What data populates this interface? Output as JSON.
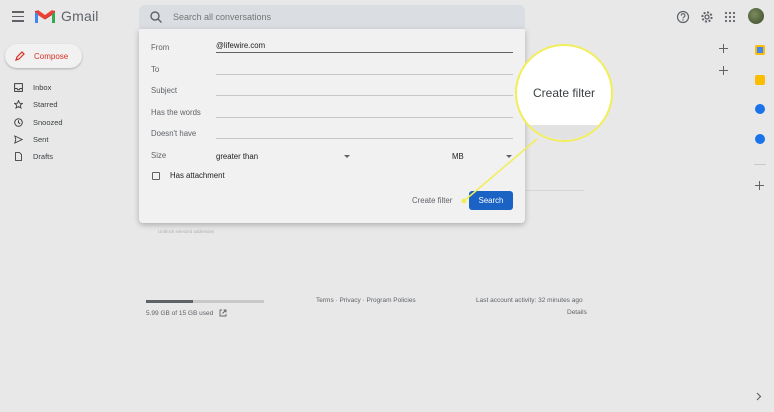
{
  "app": {
    "logo_text": "Gmail"
  },
  "search": {
    "placeholder": "Search all conversations"
  },
  "compose": {
    "label": "Compose"
  },
  "nav": {
    "items": [
      {
        "label": "Inbox",
        "icon": "inbox-icon"
      },
      {
        "label": "Starred",
        "icon": "star-icon"
      },
      {
        "label": "Snoozed",
        "icon": "clock-icon"
      },
      {
        "label": "Sent",
        "icon": "send-icon"
      },
      {
        "label": "Drafts",
        "icon": "draft-icon"
      }
    ]
  },
  "filter": {
    "from_label": "From",
    "from_value": "@lifewire.com",
    "to_label": "To",
    "to_value": "",
    "subject_label": "Subject",
    "subject_value": "",
    "has_words_label": "Has the words",
    "has_words_value": "",
    "doesnt_have_label": "Doesn't have",
    "doesnt_have_value": "",
    "size_label": "Size",
    "size_operator": "greater than",
    "size_unit": "MB",
    "attachment_label": "Has attachment",
    "create_filter_label": "Create filter",
    "search_button_label": "Search"
  },
  "background": {
    "unblock_text": "Unblock selected addresses"
  },
  "footer": {
    "storage_text": "5.99 GB of 15 GB used",
    "storage_fraction": 0.4,
    "links_text": "Terms · Privacy · Program Policies",
    "activity_text": "Last account activity: 32 minutes ago",
    "details_label": "Details"
  },
  "callout": {
    "text": "Create filter"
  },
  "colors": {
    "accent": "#1a62c4",
    "compose_text": "#d93025",
    "highlight": "#f1ee5a"
  }
}
